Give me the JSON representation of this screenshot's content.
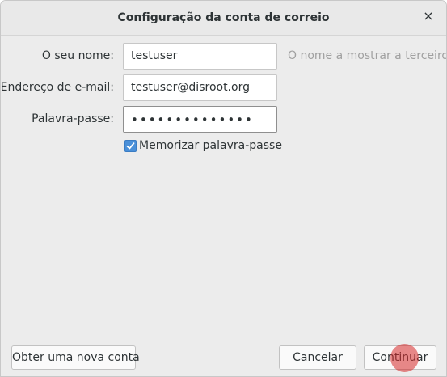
{
  "dialog": {
    "title": "Configuração da conta de correio",
    "close_icon": "×"
  },
  "form": {
    "name_label": "O seu nome:",
    "name_value": "testuser",
    "name_hint": "O nome a mostrar a terceiros",
    "email_label": "Endereço de e-mail:",
    "email_value": "testuser@disroot.org",
    "password_label": "Palavra-passe:",
    "password_masked": "••••••••••••••",
    "remember_label": "Memorizar palavra-passe",
    "remember_checked": true
  },
  "buttons": {
    "new_account": "Obter uma nova conta",
    "cancel": "Cancelar",
    "continue": "Continuar"
  },
  "colors": {
    "accent": "#4a90d9",
    "click_marker": "#d62828"
  }
}
